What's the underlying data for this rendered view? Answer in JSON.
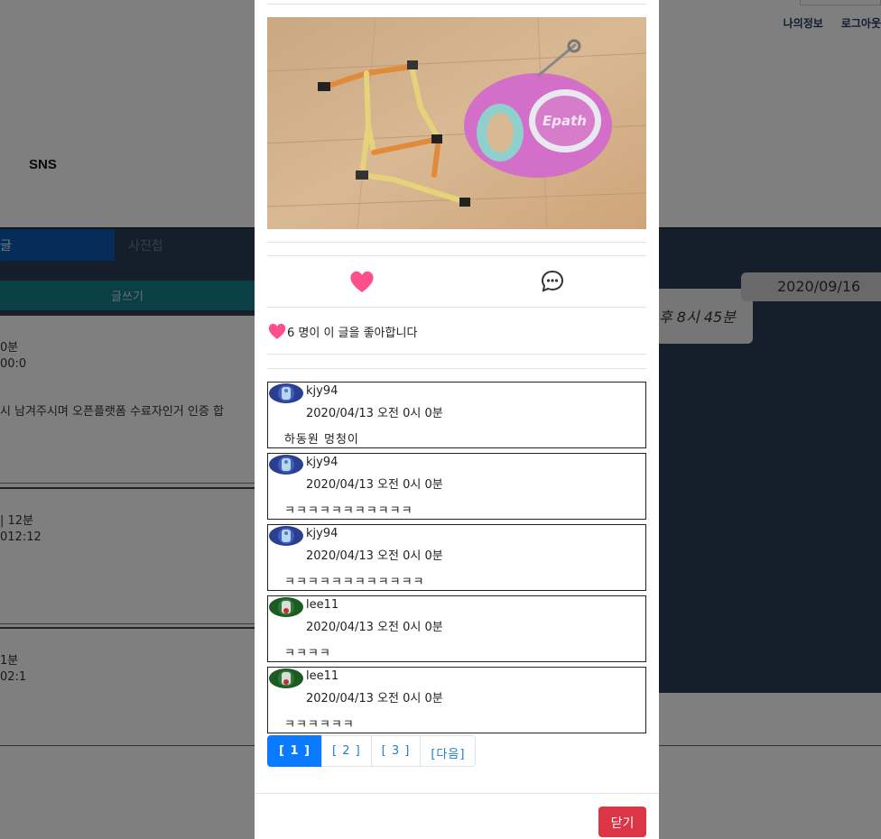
{
  "background": {
    "header_links": [
      "나의정보",
      "로그아웃"
    ],
    "logo": "SNS",
    "tabs": [
      "글",
      "사진첩"
    ],
    "write_button": "글쓰기",
    "posts": [
      {
        "time": "0분",
        "sub": "00:0",
        "body": "시 남겨주시며 오픈플랫폼 수료자인거 인증 합"
      },
      {
        "time": "| 12분",
        "sub": "012:12",
        "body": ""
      },
      {
        "time": "1분",
        "sub": "02:1",
        "body": ""
      }
    ],
    "chat_time": "후 8시 45분",
    "date_pill": "2020/09/16"
  },
  "modal": {
    "likes_text": "6 명이 이 글을 좋아합니다",
    "like_count": 6,
    "comments": [
      {
        "user": "kjy94",
        "date": "2020/04/13 오전 0시 0분",
        "text": "하동원 멍청이",
        "avatar": "blue"
      },
      {
        "user": "kjy94",
        "date": "2020/04/13 오전 0시 0분",
        "text": "ㅋㅋㅋㅋㅋㅋㅋㅋㅋㅋㅋ",
        "avatar": "blue"
      },
      {
        "user": "kjy94",
        "date": "2020/04/13 오전 0시 0분",
        "text": "ㅋㅋㅋㅋㅋㅋㅋㅋㅋㅋㅋㅋ",
        "avatar": "blue"
      },
      {
        "user": "lee11",
        "date": "2020/04/13 오전 0시 0분",
        "text": "ㅋㅋㅋㅋ",
        "avatar": "green"
      },
      {
        "user": "lee11",
        "date": "2020/04/13 오전 0시 0분",
        "text": "ㅋㅋㅋㅋㅋㅋ",
        "avatar": "green"
      }
    ],
    "pagination": [
      "[ 1 ]",
      "[ 2 ]",
      "[ 3 ]",
      "[다음]"
    ],
    "close_label": "닫기"
  },
  "colors": {
    "heart": "#ff4f8b",
    "primary": "#0a7bff",
    "danger": "#dc3545"
  }
}
